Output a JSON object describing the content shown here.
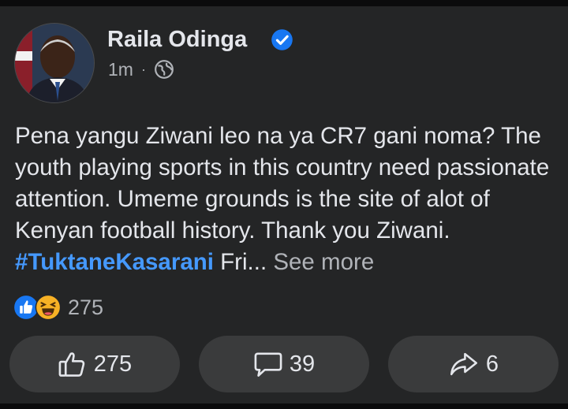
{
  "post": {
    "author": "Raila Odinga",
    "time": "1m",
    "separator": "·",
    "text_main": "Pena yangu Ziwani leo na ya CR7 gani noma? The youth playing sports in this country need passionate attention. Umeme grounds is the site of alot of Kenyan football history. Thank you Ziwani. ",
    "hashtag": "#TuktaneKasarani",
    "text_tail": " Fri...",
    "see_more": "See more"
  },
  "reactions": {
    "count": "275",
    "icons": [
      "like-reaction-icon",
      "haha-reaction-icon"
    ]
  },
  "actions": {
    "like_count": "275",
    "comment_count": "39",
    "share_count": "6"
  },
  "colors": {
    "background": "#242526",
    "button": "#3a3b3c",
    "hashtag": "#4599ff",
    "verified": "#1877f2",
    "like_reaction": "#1877f2",
    "haha_reaction": "#f7b125"
  }
}
